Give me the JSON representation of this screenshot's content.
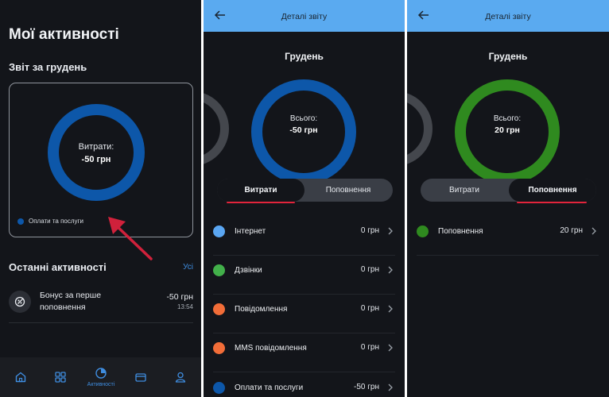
{
  "screen1": {
    "title": "Мої активності",
    "report_title": "Звіт за грудень",
    "ring": {
      "label": "Витрати:",
      "value": "-50 грн",
      "color": "#0d57a9"
    },
    "legend": [
      {
        "label": "Оплати та послуги",
        "color": "#0d57a9"
      }
    ],
    "recent_title": "Останні активності",
    "see_all": "Усі",
    "activities": [
      {
        "title": "Бонус за перше поповнення",
        "amount": "-50 грн",
        "time": "13:54",
        "icon": "bonus-icon"
      }
    ],
    "nav": [
      {
        "name": "home-icon",
        "label": ""
      },
      {
        "name": "grid-icon",
        "label": ""
      },
      {
        "name": "activities-icon",
        "label": "Активності",
        "active": true
      },
      {
        "name": "wallet-icon",
        "label": ""
      },
      {
        "name": "profile-icon",
        "label": ""
      }
    ]
  },
  "screen2": {
    "header": "Деталі звіту",
    "month": "Грудень",
    "ring": {
      "label": "Всього:",
      "value": "-50 грн",
      "color": "#0d57a9"
    },
    "toggle": {
      "left": "Витрати",
      "right": "Поповнення",
      "active": "left"
    },
    "categories": [
      {
        "name": "Інтернет",
        "amount": "0 грн",
        "color": "#5aa6f2"
      },
      {
        "name": "Дзвінки",
        "amount": "0 грн",
        "color": "#42b04a"
      },
      {
        "name": "Повідомлення",
        "amount": "0 грн",
        "color": "#f26d38"
      },
      {
        "name": "MMS повідомлення",
        "amount": "0 грн",
        "color": "#f26d38"
      },
      {
        "name": "Оплати та послуги",
        "amount": "-50 грн",
        "color": "#0d57a9"
      }
    ]
  },
  "screen3": {
    "header": "Деталі звіту",
    "month": "Грудень",
    "ring": {
      "label": "Всього:",
      "value": "20 грн",
      "color": "#2f8a1f"
    },
    "toggle": {
      "left": "Витрати",
      "right": "Поповнення",
      "active": "right"
    },
    "categories": [
      {
        "name": "Поповнення",
        "amount": "20 грн",
        "color": "#2f8a1f"
      }
    ]
  },
  "colors": {
    "accent": "#3f8de0",
    "header": "#5aaaf0",
    "highlight": "#e2243b",
    "background": "#13151a"
  }
}
